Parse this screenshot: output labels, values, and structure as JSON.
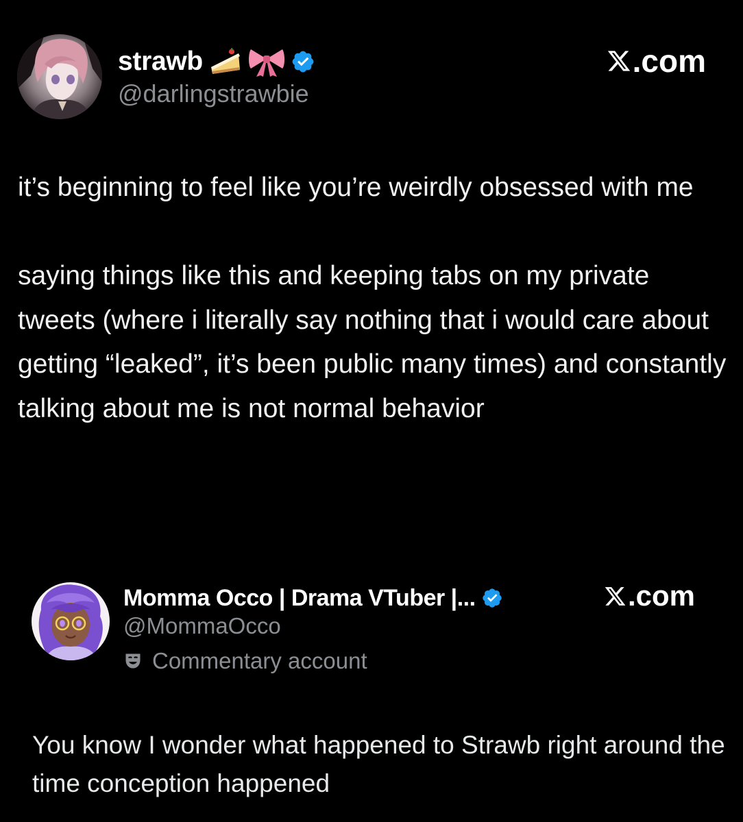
{
  "posts": [
    {
      "display_name": "strawb",
      "name_emojis": [
        "cake-emoji",
        "ribbon-emoji"
      ],
      "verified": true,
      "handle": "@darlingstrawbie",
      "brand": ".com",
      "body": "it’s beginning to feel like you’re weirdly obsessed with me\n\nsaying things like this and keeping tabs on my private tweets (where i literally say nothing that i would care about getting “leaked”, it’s been public many times) and constantly talking about me is not normal behavior"
    },
    {
      "display_name": "Momma Occo | Drama VTuber |...",
      "verified": true,
      "handle": "@MommaOcco",
      "affiliation_icon": "theater-mask-icon",
      "affiliation_label": "Commentary account",
      "brand": ".com",
      "body": "You know I wonder what happened to Strawb right around the time conception happened"
    }
  ],
  "colors": {
    "background": "#000000",
    "text": "#e7e9ea",
    "secondary_text": "#8b8f94",
    "verified_badge": "#1d9bf0"
  }
}
